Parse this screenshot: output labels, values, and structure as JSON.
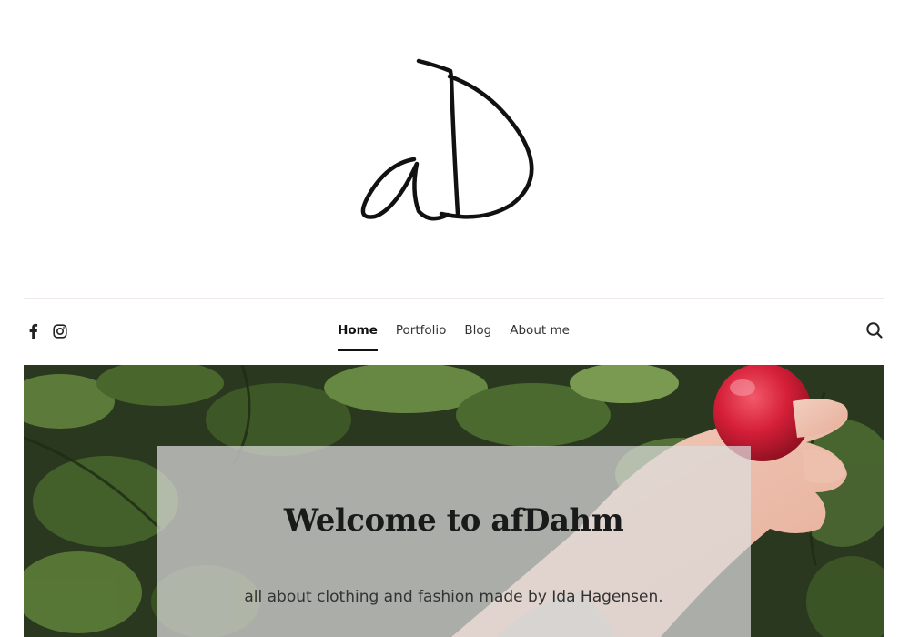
{
  "site": {
    "logo_text": "aD",
    "logo_color": "#111111"
  },
  "social": {
    "items": [
      {
        "name": "facebook",
        "icon": "facebook-icon"
      },
      {
        "name": "instagram",
        "icon": "instagram-icon"
      }
    ]
  },
  "nav": {
    "items": [
      {
        "label": "Home",
        "active": true
      },
      {
        "label": "Portfolio",
        "active": false
      },
      {
        "label": "Blog",
        "active": false
      },
      {
        "label": "About me",
        "active": false
      }
    ],
    "search_icon": "search-icon"
  },
  "hero": {
    "title": "Welcome to afDahm",
    "subtitle": "all about clothing and fashion made by Ida Hagensen.",
    "image_subject": "hand holding a red apple among green leaves"
  },
  "colors": {
    "divider": "#eee9e6",
    "text": "#333333",
    "active": "#111111",
    "card_overlay": "rgba(220,220,220,0.72)",
    "apple_red": "#d8213a",
    "leaf_green": "#4d6b34"
  }
}
